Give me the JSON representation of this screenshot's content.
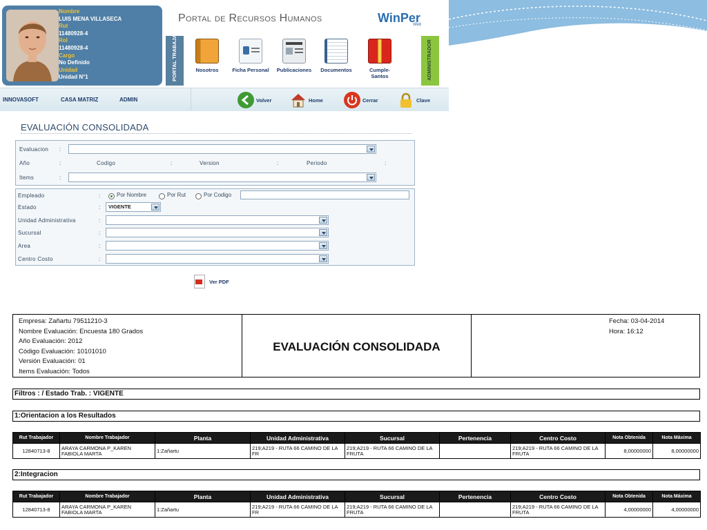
{
  "profile": {
    "fields": [
      {
        "label": "Nombre",
        "value": "LUIS MENA VILLASECA"
      },
      {
        "label": "Rut",
        "value": "11480928-4"
      },
      {
        "label": "Rol",
        "value": "11480928-4"
      },
      {
        "label": "Cargo",
        "value": "No Definido"
      },
      {
        "label": "Unidad",
        "value": "Unidad N°1"
      }
    ]
  },
  "portal": {
    "title": "Portal de Recursos Humanos",
    "logo": "WinPer",
    "logo_sub": "Web",
    "tab_left": "PORTAL TRABAJADOR",
    "tab_right": "ADMINISTRADOR",
    "nav": [
      {
        "label": "Nosotros",
        "icon": "book-icon"
      },
      {
        "label": "Ficha Personal",
        "icon": "id-card-icon"
      },
      {
        "label": "Publicaciones",
        "icon": "newspaper-icon"
      },
      {
        "label": "Documentos",
        "icon": "documents-icon"
      },
      {
        "label": "Cumple-Santos",
        "icon": "gift-icon"
      }
    ],
    "menu": [
      "INNOVASOFT",
      "CASA MATRIZ",
      "ADMIN"
    ],
    "tools": [
      "Volver",
      "Home",
      "Cerrar",
      "Clave"
    ]
  },
  "form": {
    "title": "EVALUACIÓN CONSOLIDADA",
    "evaluacion_label": "Evaluacion",
    "anio_label": "Año",
    "codigo_label": "Codigo",
    "version_label": "Version",
    "periodo_label": "Periodo",
    "items_label": "Items",
    "empleado_label": "Empleado",
    "radio_nombre": "Por Nombre",
    "radio_rut": "Por Rut",
    "radio_codigo": "Por Codigo",
    "estado_label": "Estado",
    "estado_value": "VIGENTE",
    "unidad_label": "Unidad Administrativa",
    "sucursal_label": "Sucursal",
    "area_label": "Area",
    "centro_label": "Centro Costo",
    "colon": ":",
    "pdf_label": "Ver PDF"
  },
  "colors": {
    "profile_bg": "#4f7fa6",
    "label_yellow": "#f2c230",
    "tab_trabajador": "#58809f",
    "tab_admin": "#8cc63f"
  },
  "report": {
    "empresa": "Empresa: Zañartu 79511210-3",
    "nombre": "Nombre Evaluación: Encuesta 180 Grados",
    "anio": "Año Evaluación: 2012",
    "codigo": "Código Evaluación: 10101010",
    "version": "Versión Evaluación: 01",
    "items": "Items Evaluación: Todos",
    "title": "EVALUACIÓN CONSOLIDADA",
    "fecha": "Fecha: 03-04-2014",
    "hora": "Hora: 16:12",
    "filtros": "Filtros :  / Estado Trab. : VIGENTE",
    "columns": [
      "Rut Trabajador",
      "Nombre Trabajador",
      "Planta",
      "Unidad Administrativa",
      "Sucursal",
      "Pertenencia",
      "Centro Costo",
      "Nota Obtenida",
      "Nota Máxima"
    ],
    "sections": [
      {
        "title": "1:Orientacion a los Resultados",
        "row": {
          "rut": "12840713-8",
          "nombre": "ARAYA CARMONA P_KAREN FABIOLA MARTA",
          "planta": "1:Zañartu",
          "unidad": "219;A219 - RUTA 66 CAMINO DE LA FR",
          "sucursal": "219;A219 - RUTA 66 CAMINO DE LA FRUTA",
          "pertenencia": "",
          "centro": "219;A219 - RUTA 66 CAMINO DE LA FRUTA",
          "nota": "8,00000000",
          "maxima": "8,00000000"
        }
      },
      {
        "title": "2:Integracion",
        "row": {
          "rut": "12840713-8",
          "nombre": "ARAYA CARMONA P_KAREN FABIOLA MARTA",
          "planta": "1:Zañartu",
          "unidad": "219;A219 - RUTA 66 CAMINO DE LA FR",
          "sucursal": "219;A219 - RUTA 66 CAMINO DE LA FRUTA",
          "pertenencia": "",
          "centro": "219;A219 - RUTA 66 CAMINO DE LA FRUTA",
          "nota": "4,00000000",
          "maxima": "4,00000000"
        }
      }
    ]
  }
}
